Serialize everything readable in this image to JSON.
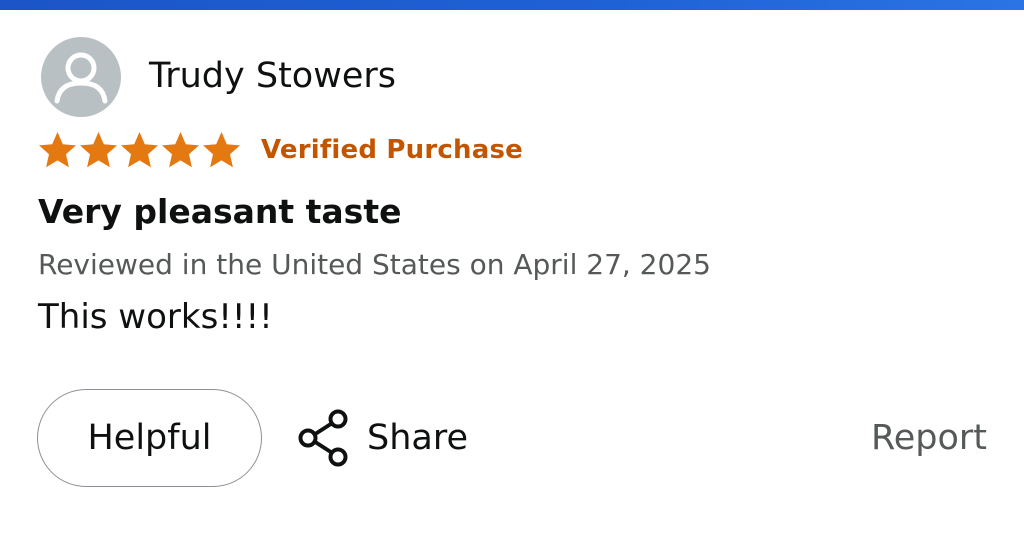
{
  "colors": {
    "accent_bar": "#1f62d6",
    "star": "#e47911",
    "verified": "#c45500",
    "text_primary": "#0f1111",
    "text_secondary": "#565959",
    "avatar_bg": "#b8c0c3"
  },
  "reviewer": {
    "name": "Trudy Stowers",
    "avatar_icon": "person-icon"
  },
  "rating": {
    "stars": 5,
    "max": 5,
    "star_icon": "star-icon"
  },
  "badge": {
    "verified_label": "Verified Purchase"
  },
  "review": {
    "title": "Very pleasant taste",
    "meta": "Reviewed in the United States on April 27, 2025",
    "body": "This works!!!!"
  },
  "actions": {
    "helpful_label": "Helpful",
    "share_label": "Share",
    "share_icon": "share-icon",
    "report_label": "Report"
  }
}
